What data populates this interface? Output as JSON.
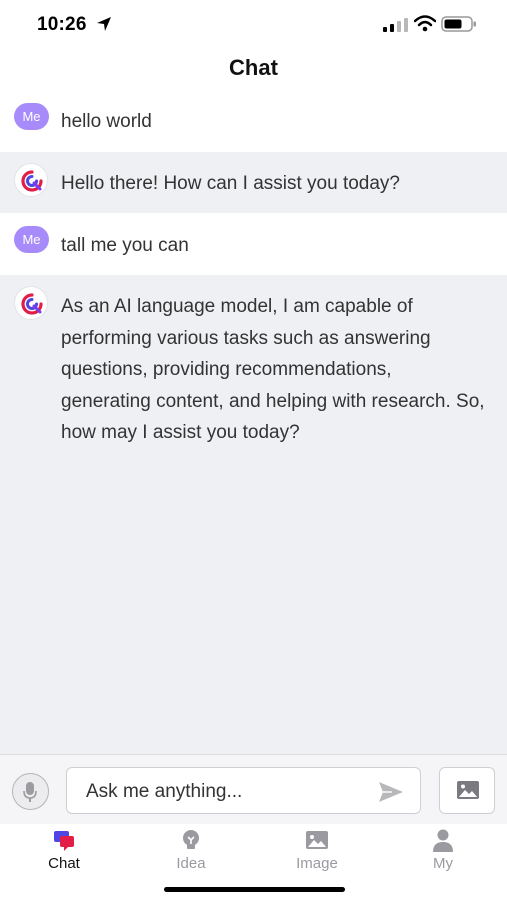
{
  "status_bar": {
    "time": "10:26"
  },
  "header": {
    "title": "Chat"
  },
  "messages": [
    {
      "role": "user",
      "avatar_label": "Me",
      "text": "hello world"
    },
    {
      "role": "bot",
      "text": "Hello there! How can I assist you today?"
    },
    {
      "role": "user",
      "avatar_label": "Me",
      "text": "tall me you can"
    },
    {
      "role": "bot",
      "text": "As an AI language model, I am capable of performing various tasks such as answering questions, providing recommendations, generating content, and helping with research. So, how may I assist you today?"
    }
  ],
  "composer": {
    "placeholder": "Ask me anything..."
  },
  "tabs": [
    {
      "label": "Chat",
      "active": true
    },
    {
      "label": "Idea",
      "active": false
    },
    {
      "label": "Image",
      "active": false
    },
    {
      "label": "My",
      "active": false
    }
  ],
  "colors": {
    "accent_purple": "#a78bfa",
    "chat_background": "#eef0f3",
    "tab_active": "#111111",
    "tab_inactive": "#9a9aa0"
  }
}
